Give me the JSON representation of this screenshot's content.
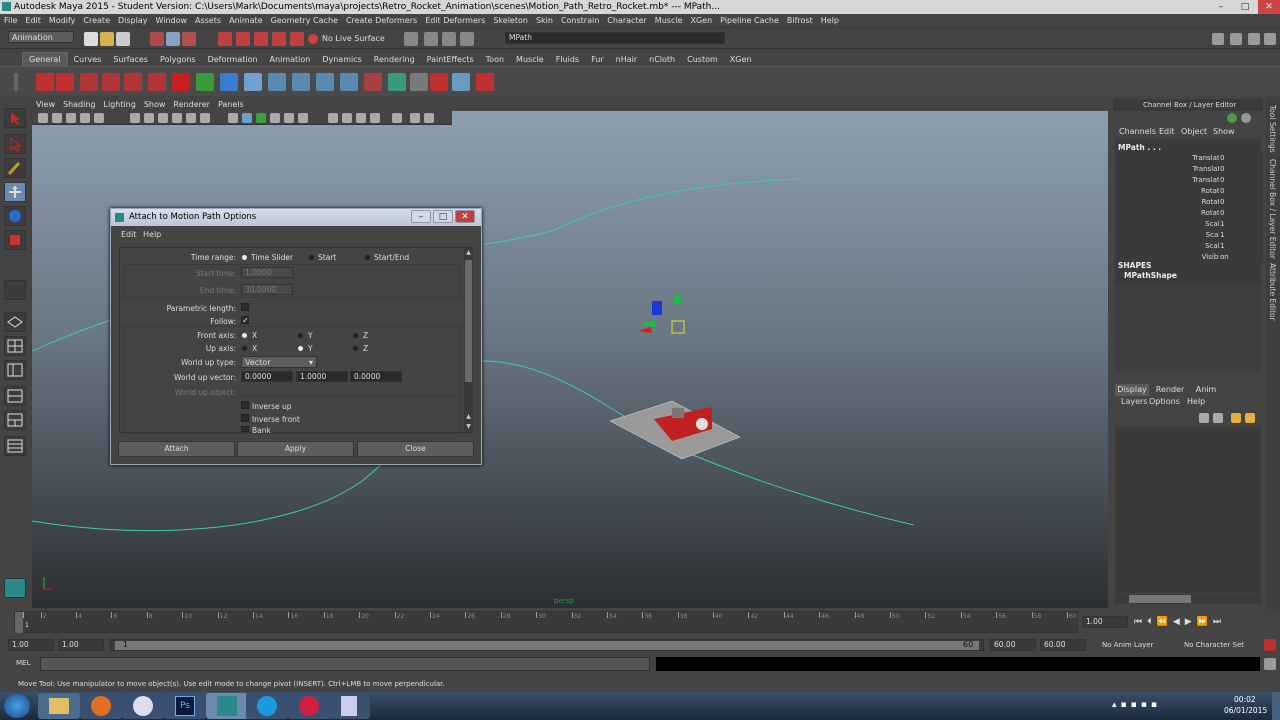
{
  "window": {
    "title": "Autodesk Maya 2015 - Student Version: C:\\Users\\Mark\\Documents\\maya\\projects\\Retro_Rocket_Animation\\scenes\\Motion_Path_Retro_Rocket.mb* --- MPath..."
  },
  "menu": [
    "File",
    "Edit",
    "Modify",
    "Create",
    "Display",
    "Window",
    "Assets",
    "Animate",
    "Geometry Cache",
    "Create Deformers",
    "Edit Deformers",
    "Skeleton",
    "Skin",
    "Constrain",
    "Character",
    "Muscle",
    "XGen",
    "Pipeline Cache",
    "Bifrost",
    "Help"
  ],
  "status_line": {
    "menu_set": "Animation",
    "live_surface": "No Live Surface",
    "object_field": "MPath"
  },
  "shelf_tabs": [
    "General",
    "Curves",
    "Surfaces",
    "Polygons",
    "Deformation",
    "Animation",
    "Dynamics",
    "Rendering",
    "PaintEffects",
    "Toon",
    "Muscle",
    "Fluids",
    "Fur",
    "nHair",
    "nCloth",
    "Custom",
    "XGen"
  ],
  "shelf_active": "General",
  "panel_menu": [
    "View",
    "Shading",
    "Lighting",
    "Show",
    "Renderer",
    "Panels"
  ],
  "dialog": {
    "title": "Attach to Motion Path Options",
    "menu": [
      "Edit",
      "Help"
    ],
    "time_range_label": "Time range:",
    "time_range_options": [
      "Time Slider",
      "Start",
      "Start/End"
    ],
    "start_time_label": "Start time:",
    "start_time_value": "1.0000",
    "end_time_label": "End time:",
    "end_time_value": "30.0000",
    "parametric_length_label": "Parametric length:",
    "follow_label": "Follow:",
    "front_axis_label": "Front axis:",
    "up_axis_label": "Up axis:",
    "axis_options": [
      "X",
      "Y",
      "Z"
    ],
    "world_up_type_label": "World up type:",
    "world_up_type_value": "Vector",
    "world_up_vector_label": "World up vector:",
    "world_up_vector": [
      "0.0000",
      "1.0000",
      "0.0000"
    ],
    "world_up_object_label": "World up object:",
    "inverse_up": "Inverse up",
    "inverse_front": "Inverse front",
    "bank": "Bank",
    "buttons": [
      "Attach",
      "Apply",
      "Close"
    ]
  },
  "channel_box": {
    "header": "Channel Box / Layer Editor",
    "menu": [
      "Channels",
      "Edit",
      "Object",
      "Show"
    ],
    "object": "MPath . . .",
    "channels": [
      {
        "name": "Translate X",
        "value": "0"
      },
      {
        "name": "Translate Y",
        "value": "0"
      },
      {
        "name": "Translate Z",
        "value": "0"
      },
      {
        "name": "Rotate X",
        "value": "0"
      },
      {
        "name": "Rotate Y",
        "value": "0"
      },
      {
        "name": "Rotate Z",
        "value": "0"
      },
      {
        "name": "Scale X",
        "value": "1"
      },
      {
        "name": "Scale Y",
        "value": "1"
      },
      {
        "name": "Scale Z",
        "value": "1"
      },
      {
        "name": "Visibility",
        "value": "on"
      }
    ],
    "shapes_label": "SHAPES",
    "shape_name": "MPathShape"
  },
  "layer_editor": {
    "tabs": [
      "Display",
      "Render",
      "Anim"
    ],
    "menu": [
      "Layers",
      "Options",
      "Help"
    ]
  },
  "side_tabs": [
    "Tool Settings",
    "Channel Box / Layer Editor",
    "Attribute Editor"
  ],
  "viewport": {
    "persp_label": "persp"
  },
  "time_slider": {
    "ticks": [
      "1",
      "2",
      "4",
      "6",
      "8",
      "10",
      "12",
      "14",
      "16",
      "18",
      "20",
      "22",
      "24",
      "26",
      "28",
      "30",
      "32",
      "34",
      "36",
      "38",
      "40",
      "42",
      "44",
      "46",
      "48",
      "50",
      "52",
      "54",
      "56",
      "58",
      "60"
    ],
    "current_frame": "1.00"
  },
  "range_slider": {
    "start": "1.00",
    "anim_start": "1.00",
    "range_in": "1",
    "range_out": "60",
    "end": "60.00",
    "anim_end": "60.00",
    "anim_layer": "No Anim Layer",
    "character_set": "No Character Set"
  },
  "command_line": {
    "label": "MEL"
  },
  "help_line": "Move Tool: Use manipulator to move object(s). Use edit mode to change pivot (INSERT).  Ctrl+LMB to move perpendicular.",
  "taskbar": {
    "time": "00:02",
    "date": "06/01/2015"
  },
  "colors": {
    "curve": "#3ec9b0",
    "dialog_title": "#c8d3e1"
  }
}
